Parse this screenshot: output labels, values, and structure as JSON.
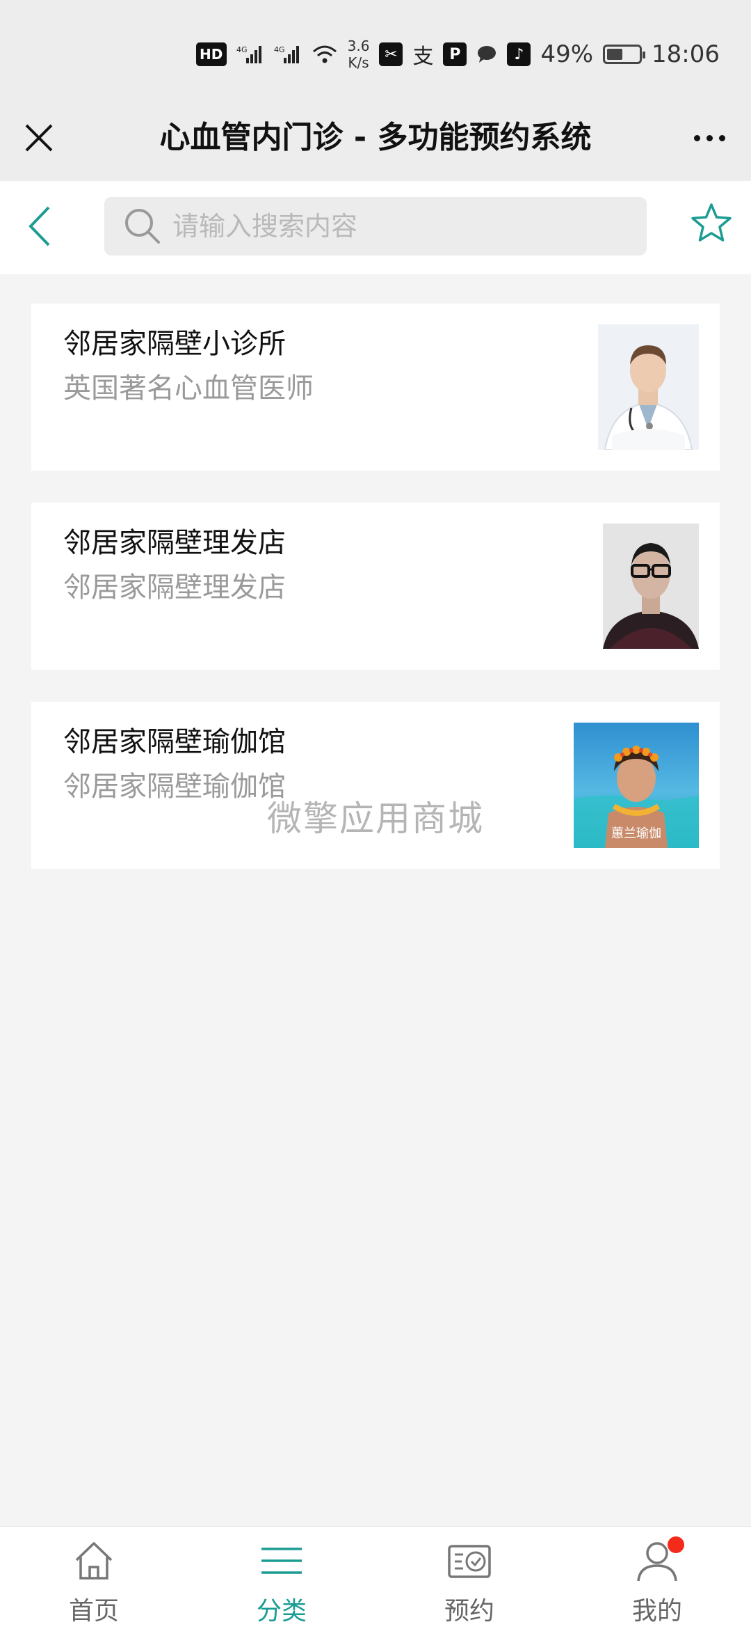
{
  "status_bar": {
    "network_labels": [
      "HD",
      "4G",
      "4G"
    ],
    "speed_value": "3.6",
    "speed_unit": "K/s",
    "battery_percent": "49%",
    "battery_level": 0.49,
    "time": "18:06",
    "app_icons": [
      "capcut-icon",
      "alipay-icon",
      "pinduoduo-icon",
      "chat-bubble-icon",
      "douyin-icon"
    ]
  },
  "title_bar": {
    "title": "心血管内门诊 - 多功能预约系统"
  },
  "search": {
    "placeholder": "请输入搜索内容",
    "value": ""
  },
  "items": [
    {
      "title": "邻居家隔壁小诊所",
      "subtitle": "英国著名心血管医师",
      "image": "doctor-photo"
    },
    {
      "title": "邻居家隔壁理发店",
      "subtitle": "邻居家隔壁理发店",
      "image": "barber-photo"
    },
    {
      "title": "邻居家隔壁瑜伽馆",
      "subtitle": "邻居家隔壁瑜伽馆",
      "image": "yoga-photo",
      "image_caption": "蕙兰瑜伽"
    }
  ],
  "watermark": "微擎应用商城",
  "tabs": [
    {
      "label": "首页",
      "icon": "home-icon",
      "active": false
    },
    {
      "label": "分类",
      "icon": "menu-lines-icon",
      "active": true
    },
    {
      "label": "预约",
      "icon": "booking-icon",
      "active": false
    },
    {
      "label": "我的",
      "icon": "user-icon",
      "active": false,
      "badge": true
    }
  ],
  "colors": {
    "accent": "#1b9c93",
    "badge": "#f42a1b",
    "background": "#f4f4f4"
  }
}
